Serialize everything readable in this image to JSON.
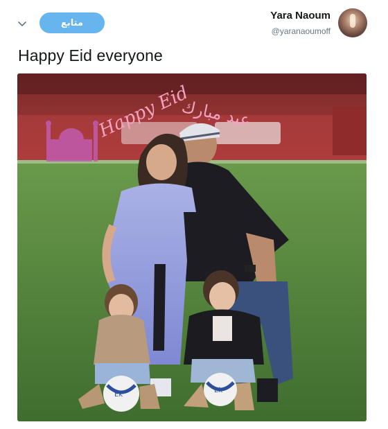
{
  "header": {
    "follow_label": "متابع",
    "author_name": "Yara Naoum",
    "author_handle": "@yaranaoumoff"
  },
  "tweet": {
    "text": "Happy Eid everyone"
  },
  "photo": {
    "overlay_text_en": "Happy Eid",
    "overlay_text_ar": "عيد مبارك",
    "ball_label_1": "Ek",
    "ball_label_2": "Ek"
  },
  "colors": {
    "follow_button": "#66b5ef",
    "handle_gray": "#657786",
    "overlay_pink": "#f3a3c0",
    "crescent_purple": "#8e3aa0"
  },
  "icons": {
    "chevron": "chevron-down-icon"
  }
}
